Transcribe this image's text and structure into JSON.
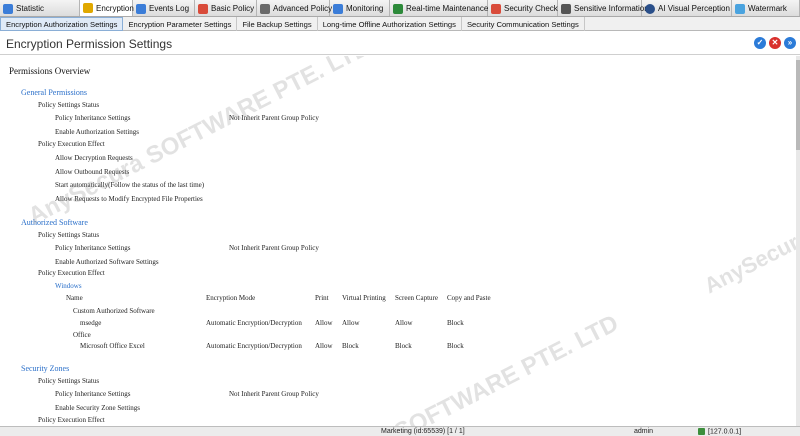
{
  "top_tabs": [
    {
      "label": "Statistic",
      "icon": "statistics-icon",
      "color": "#3b7dd8",
      "active": false
    },
    {
      "label": "Encryption",
      "icon": "lock-icon",
      "color": "#e0a800",
      "active": true
    },
    {
      "label": "Events Log",
      "icon": "log-icon",
      "color": "#3b7dd8",
      "active": false
    },
    {
      "label": "Basic Policy",
      "icon": "policy-icon",
      "color": "#d94b3a",
      "active": false
    },
    {
      "label": "Advanced Policy",
      "icon": "advanced-policy-icon",
      "color": "#6a6a6a",
      "active": false
    },
    {
      "label": "Monitoring",
      "icon": "monitor-icon",
      "color": "#3b7dd8",
      "active": false
    },
    {
      "label": "Real-time Maintenance",
      "icon": "maintenance-icon",
      "color": "#2d8a3a",
      "active": false
    },
    {
      "label": "Security Check",
      "icon": "security-check-icon",
      "color": "#d94b3a",
      "active": false
    },
    {
      "label": "Sensitive Information",
      "icon": "sensitive-icon",
      "color": "#555555",
      "active": false
    },
    {
      "label": "AI Visual Perception",
      "icon": "ai-icon",
      "color": "#2a4f8a",
      "active": false
    },
    {
      "label": "Watermark",
      "icon": "watermark-icon",
      "color": "#4aa3df",
      "active": false
    }
  ],
  "sub_tabs": [
    {
      "label": "Encryption Authorization Settings",
      "active": true
    },
    {
      "label": "Encryption Parameter Settings",
      "active": false
    },
    {
      "label": "File Backup Settings",
      "active": false
    },
    {
      "label": "Long-time Offline Authorization Settings",
      "active": false
    },
    {
      "label": "Security Communication Settings",
      "active": false
    }
  ],
  "page_title": "Encryption Permission Settings",
  "title_buttons": {
    "ok": "✓",
    "close": "✕",
    "more": "»"
  },
  "overview_title": "Permissions Overview",
  "general": {
    "title": "General Permissions",
    "status_label": "Policy Settings Status",
    "inherit_label": "Policy Inheritance Settings",
    "inherit_value": "Not Inherit Parent Group Policy",
    "enable_label": "Enable Authorization Settings",
    "effect_label": "Policy Execution Effect",
    "effects": [
      "Allow Decryption Requests",
      "Allow Outbound Requests",
      "Start automatically(Follow the status of the last time)",
      "Allow Requests to Modify Encrypted File Properties"
    ]
  },
  "software": {
    "title": "Authorized Software",
    "status_label": "Policy Settings Status",
    "inherit_label": "Policy Inheritance Settings",
    "inherit_value": "Not Inherit Parent Group Policy",
    "enable_label": "Enable Authorized Software Settings",
    "effect_label": "Policy Execution Effect",
    "os_label": "Windows",
    "columns": {
      "name": "Name",
      "mode": "Encryption Mode",
      "print": "Print",
      "virtual": "Virtual Printing",
      "capture": "Screen Capture",
      "copy": "Copy and Paste"
    },
    "group1": "Custom Authorized Software",
    "row1": {
      "name": "msedge",
      "mode": "Automatic Encryption/Decryption",
      "print": "Allow",
      "virtual": "Allow",
      "capture": "Allow",
      "copy": "Block"
    },
    "group2": "Office",
    "row2": {
      "name": "Microsoft Office Excel",
      "mode": "Automatic Encryption/Decryption",
      "print": "Allow",
      "virtual": "Block",
      "capture": "Block",
      "copy": "Block"
    }
  },
  "zones": {
    "title": "Security Zones",
    "status_label": "Policy Settings Status",
    "inherit_label": "Policy Inheritance Settings",
    "inherit_value": "Not Inherit Parent Group Policy",
    "enable_label": "Enable Security Zone Settings",
    "effect_label": "Policy Execution Effect"
  },
  "watermarks": {
    "wm1": "AnySecura SOFTWARE PTE. LTD",
    "wm2": "SOFTWARE PTE. LTD",
    "wm3": "AnySecura",
    "wm4": "SOFTWARE PTE. LTD"
  },
  "status": {
    "group": "Marketing (id:65539) [1 / 1]",
    "user": "admin",
    "ip": "[127.0.0.1]"
  },
  "colors": {
    "accent": "#2a6fc9",
    "ok": "#2b7bd8",
    "close": "#d9302c",
    "more": "#2b7bd8"
  }
}
